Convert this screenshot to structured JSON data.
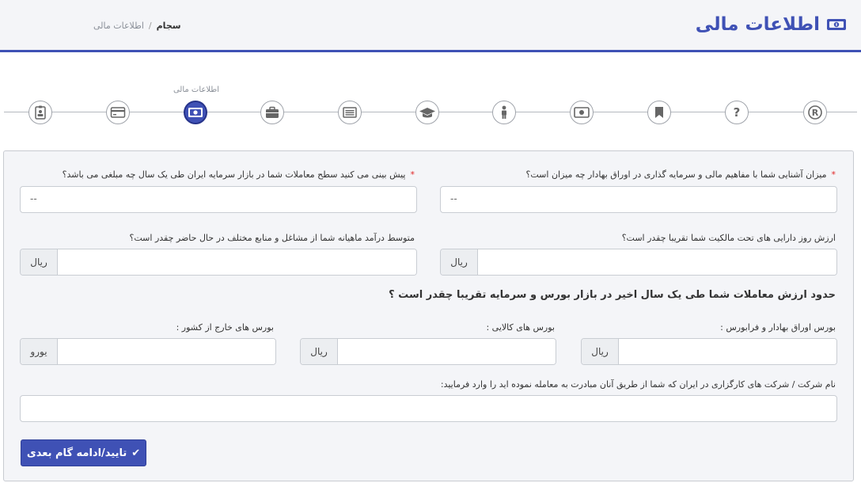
{
  "header": {
    "title": "اطلاعات مالی",
    "title_icon": "money-icon",
    "breadcrumb": {
      "active": "سجام",
      "separator": "/",
      "current": "اطلاعات مالی"
    },
    "accent_color": "#3f51b5"
  },
  "stepper": {
    "active_label": "اطلاعات مالی",
    "steps": [
      {
        "icon": "registered-icon",
        "status": "inactive"
      },
      {
        "icon": "question-icon",
        "status": "inactive"
      },
      {
        "icon": "bookmark-icon",
        "status": "inactive"
      },
      {
        "icon": "money-icon",
        "status": "inactive"
      },
      {
        "icon": "person-icon",
        "status": "inactive"
      },
      {
        "icon": "graduation-cap-icon",
        "status": "inactive"
      },
      {
        "icon": "list-icon",
        "status": "inactive"
      },
      {
        "icon": "briefcase-icon",
        "status": "inactive"
      },
      {
        "icon": "money-icon",
        "status": "active"
      },
      {
        "icon": "credit-card-icon",
        "status": "inactive"
      },
      {
        "icon": "id-badge-icon",
        "status": "inactive"
      }
    ]
  },
  "form": {
    "familiarity": {
      "label": "میزان آشنایی شما با مفاهیم مالی و سرمایه گذاری در اوراق بهادار چه میزان است؟",
      "required_mark": "*",
      "value": "--"
    },
    "forecast": {
      "label": "پیش بینی می کنید سطح معاملات شما در بازار سرمایه ایران طی یک سال چه مبلغی می باشد؟",
      "required_mark": "*",
      "value": "--"
    },
    "asset_value": {
      "label": "ارزش روز دارایی های تحت مالکیت شما تقریبا چقدر است؟",
      "unit": "ریال",
      "value": ""
    },
    "monthly_income": {
      "label": "متوسط درآمد ماهیانه شما از مشاغل و منابع مختلف در حال حاضر چقدر است؟",
      "unit": "ریال",
      "value": ""
    },
    "trade_section_heading": "حدود ارزش معاملات شما طی یک سال اخیر در بازار بورس و سرمایه تقریبا چقدر است ؟",
    "stock_exchange": {
      "label": "بورس اوراق بهادار و فرابورس :",
      "unit": "ریال",
      "value": ""
    },
    "commodity_exchange": {
      "label": "بورس های کالایی :",
      "unit": "ریال",
      "value": ""
    },
    "foreign_exchange": {
      "label": "بورس های خارج از کشور :",
      "unit": "یورو",
      "value": ""
    },
    "brokers": {
      "label": "نام شرکت / شرکت های کارگزاری در ایران که شما از طریق آنان مبادرت به معامله نموده اید را وارد فرمایید:",
      "value": ""
    },
    "submit_label": "تایید/ادامه گام بعدی",
    "submit_icon": "check-icon"
  }
}
